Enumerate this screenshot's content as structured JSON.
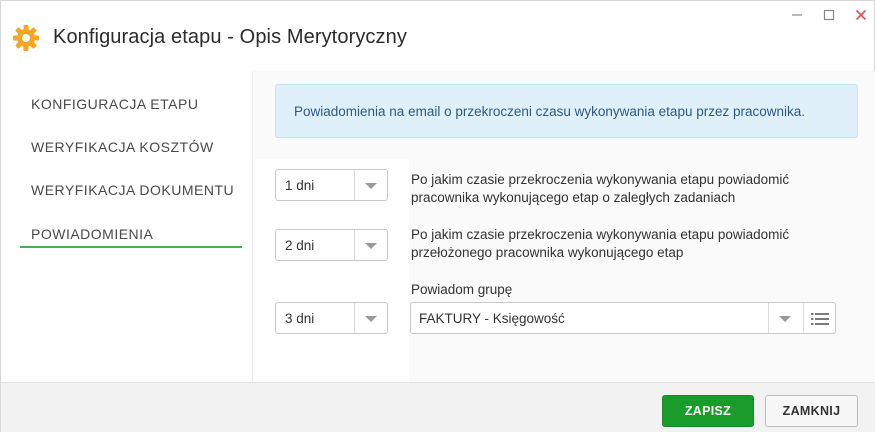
{
  "window": {
    "title": "Konfiguracja etapu - Opis Merytoryczny",
    "controls": {
      "minimize": "minimize",
      "maximize": "maximize",
      "close": "close"
    }
  },
  "colors": {
    "accent": "#4caf50",
    "icon": "#f5a623",
    "save": "#1a9c2a",
    "info_bg": "#dff0fa",
    "info_text": "#2b5a86"
  },
  "icons": {
    "title": "gear-icon",
    "caret": "chevron-down-icon",
    "list": "list-icon"
  },
  "sidebar": {
    "items": [
      {
        "label": "KONFIGURACJA ETAPU"
      },
      {
        "label": "WERYFIKACJA KOSZTÓW"
      },
      {
        "label": "WERYFIKACJA DOKUMENTU"
      },
      {
        "label": "POWIADOMIENIA",
        "active": true
      }
    ]
  },
  "main": {
    "info": "Powiadomienia na email o przekroczeni czasu wykonywania etapu przez pracownika.",
    "rows": [
      {
        "value": "1 dni",
        "description_line1": "Po jakim czasie przekroczenia wykonywania etapu powiadomić",
        "description_line2": "pracownika wykonującego etap o zaległych zadaniach"
      },
      {
        "value": "2 dni",
        "description_line1": "Po jakim czasie przekroczenia wykonywania etapu powiadomić",
        "description_line2": "przełożonego pracownika wykonującego etap"
      },
      {
        "value": "3 dni",
        "group_label": "Powiadom grupę",
        "group_value": "FAKTURY - Księgowość"
      }
    ]
  },
  "footer": {
    "save_label": "ZAPISZ",
    "close_label": "ZAMKNIJ"
  }
}
